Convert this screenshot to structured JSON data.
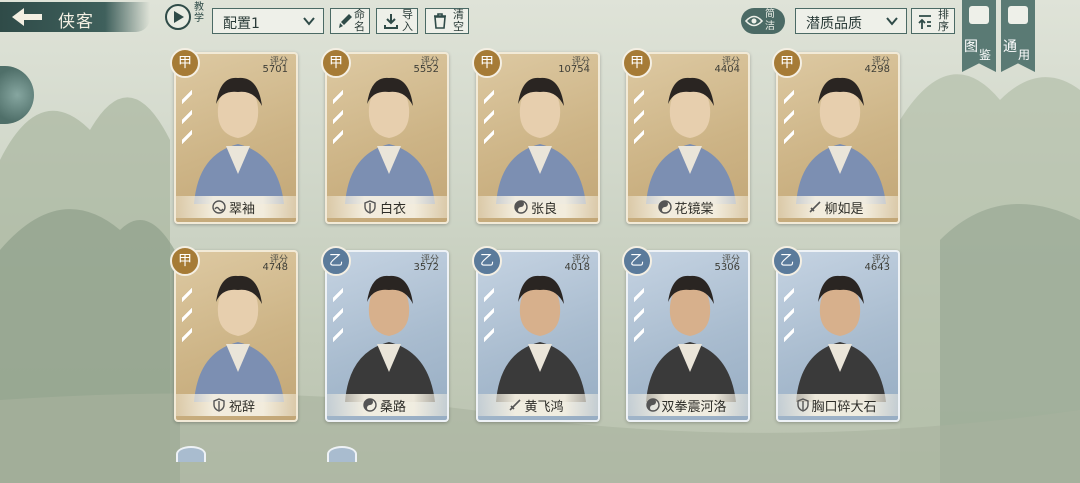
{
  "header": {
    "back_label": "侠客",
    "tutorial_label": "教学",
    "config_value": "配置1",
    "rename_label": "命名",
    "import_label": "导入",
    "clear_label": "清空",
    "simple_label": "简洁",
    "quality_value": "潜质品质",
    "sort_label": "排序"
  },
  "side_banners": [
    {
      "label_1": "图",
      "label_2": "鉴"
    },
    {
      "label_1": "通",
      "label_2": "用"
    }
  ],
  "score_label": "评分",
  "cards": [
    {
      "grade": "甲",
      "score": "5701",
      "name": "翠袖",
      "sect_icon": "wave-sect-icon",
      "tier": "jia"
    },
    {
      "grade": "甲",
      "score": "5552",
      "name": "白衣",
      "sect_icon": "shield-sect-icon",
      "tier": "jia"
    },
    {
      "grade": "甲",
      "score": "10754",
      "name": "张良",
      "sect_icon": "yinyang-sect-icon",
      "tier": "jia"
    },
    {
      "grade": "甲",
      "score": "4404",
      "name": "花镜棠",
      "sect_icon": "yinyang-sect-icon",
      "tier": "jia"
    },
    {
      "grade": "甲",
      "score": "4298",
      "name": "柳如是",
      "sect_icon": "sword-sect-icon",
      "tier": "jia"
    },
    {
      "grade": "甲",
      "score": "4748",
      "name": "祝辞",
      "sect_icon": "shield-sect-icon",
      "tier": "jia"
    },
    {
      "grade": "乙",
      "score": "3572",
      "name": "桑路",
      "sect_icon": "yinyang-sect-icon",
      "tier": "yi"
    },
    {
      "grade": "乙",
      "score": "4018",
      "name": "黄飞鸿",
      "sect_icon": "sword-sect-icon",
      "tier": "yi"
    },
    {
      "grade": "乙",
      "score": "5306",
      "name": "双拳震河洛",
      "sect_icon": "yinyang-sect-icon",
      "tier": "yi"
    },
    {
      "grade": "乙",
      "score": "4643",
      "name": "胸口碎大石",
      "sect_icon": "shield-sect-icon",
      "tier": "yi"
    }
  ],
  "colors": {
    "accent": "#4b6a65",
    "jia": "#a67b36",
    "yi": "#5b7b9b"
  }
}
